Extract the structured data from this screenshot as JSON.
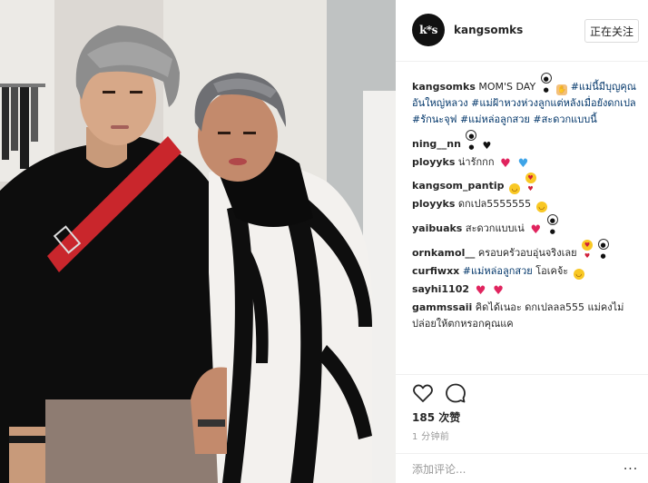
{
  "post": {
    "username": "kangsomks",
    "avatar_text": "k*s",
    "follow_label": "正在关注",
    "likes_label": "185 次赞",
    "time_label": "1 分钟前",
    "comment_placeholder": "添加评论...",
    "more_label": "···"
  },
  "caption": {
    "user": "kangsomks",
    "text_plain": "MOM'S DAY",
    "emojis": [
      "panda",
      "hand"
    ],
    "hashtags": [
      "#แม่นี้มีบุญคุณอันใหญ่หลวง",
      "#แม่ฝ้าหวงห่วงลูกแต่หลังเมื่อยังดกเปล",
      "#รักนะจุฟ",
      "#แม่หล่อลูกสวย",
      "#สะดวกแบบนี้"
    ]
  },
  "comments": [
    {
      "user": "ning__nn",
      "text": "",
      "emojis": [
        "panda",
        "heart-black"
      ]
    },
    {
      "user": "ployyks",
      "text": "น่ารักกก",
      "emojis": [
        "heart-red",
        "heart-blue"
      ]
    },
    {
      "user": "kangsom_pantip",
      "text": "",
      "emojis": [
        "smile",
        "love-face"
      ]
    },
    {
      "user": "ployyks",
      "text": "ดกเปล5555555",
      "emojis": [
        "smile"
      ]
    },
    {
      "user": "yaibuaks",
      "text": "สะดวกแบบเน่",
      "emojis": [
        "heart-red",
        "panda"
      ]
    },
    {
      "user": "ornkamol__",
      "text": "ครอบครัวอบอุ่นจริงเลย",
      "emojis": [
        "love-face",
        "panda"
      ]
    },
    {
      "user": "curfiwxx",
      "text": "โอเคจ้ะ",
      "tag": "#แม่หล่อลูกสวย",
      "emojis": [
        "smile"
      ]
    },
    {
      "user": "sayhi1102",
      "text": "",
      "emojis": [
        "heart-red",
        "heart-red"
      ]
    },
    {
      "user": "gammssaii",
      "text": "คิดได้เนอะ ดกเปลลล555 แม่คงไม่ปล่อยให้ตกหรอกคุณแค",
      "emojis": []
    }
  ],
  "icons": {
    "like": "heart-outline-icon",
    "comment": "speech-bubble-icon",
    "more": "more-dots-icon"
  },
  "colors": {
    "hashtag": "#003569",
    "text": "#262626",
    "muted": "#999999",
    "border": "#efefef"
  }
}
